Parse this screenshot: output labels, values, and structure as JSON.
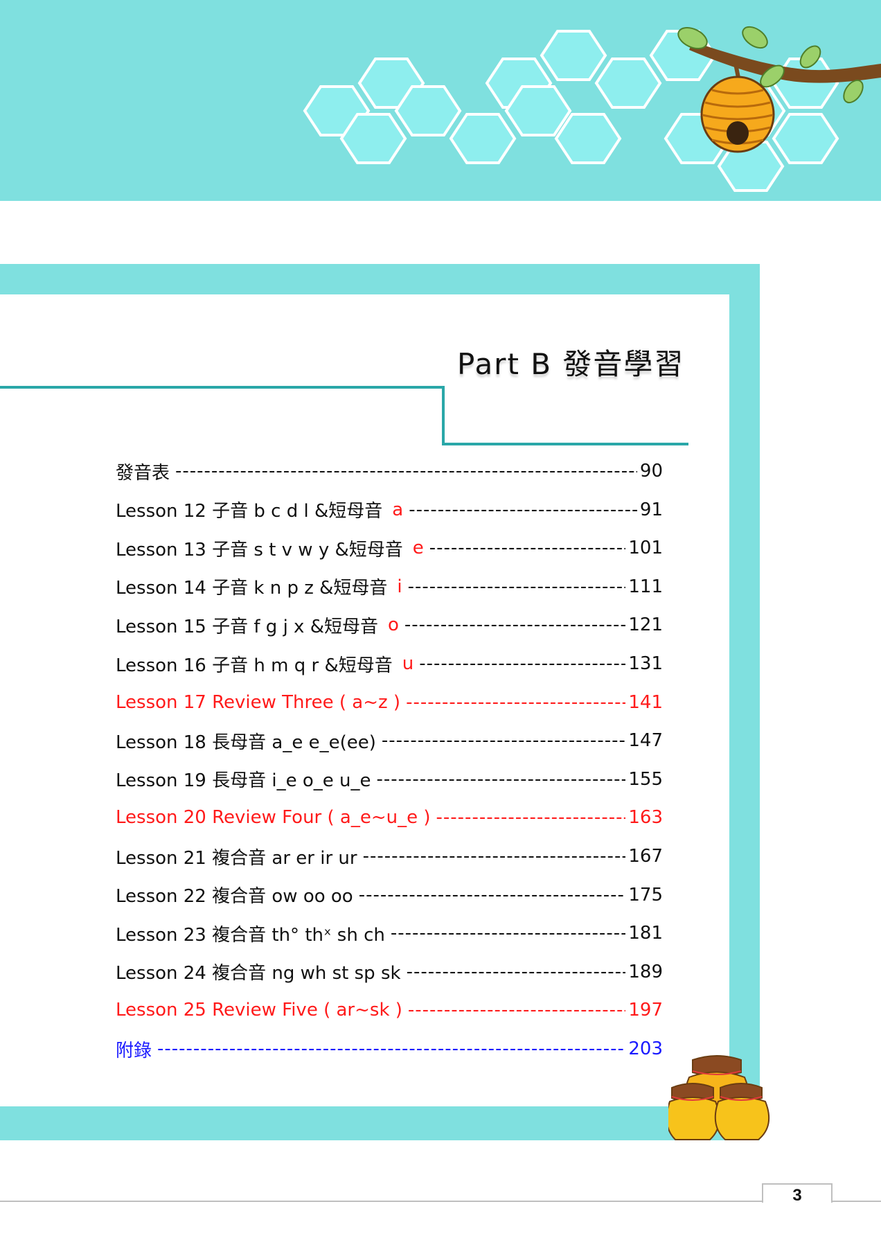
{
  "title": "Part B 發音學習",
  "toc": [
    {
      "label": "發音表",
      "highlight": "",
      "page": "90",
      "style": "normal"
    },
    {
      "label": "Lesson 12 子音 b c d l &短母音",
      "highlight": "a",
      "page": "91",
      "style": "normal"
    },
    {
      "label": "Lesson 13 子音 s t v w y &短母音",
      "highlight": "e",
      "page": "101",
      "style": "normal"
    },
    {
      "label": "Lesson 14 子音 k n p z &短母音",
      "highlight": "i",
      "page": "111",
      "style": "normal"
    },
    {
      "label": "Lesson 15 子音 f g j x &短母音",
      "highlight": "o",
      "page": "121",
      "style": "normal"
    },
    {
      "label": "Lesson 16 子音 h m q r &短母音",
      "highlight": "u",
      "page": "131",
      "style": "normal"
    },
    {
      "label": "Lesson 17 Review Three ( a~z )",
      "highlight": "",
      "page": "141",
      "style": "red"
    },
    {
      "label": "Lesson 18 長母音 a_e e_e(ee)",
      "highlight": "",
      "page": "147",
      "style": "normal"
    },
    {
      "label": "Lesson 19 長母音 i_e o_e u_e",
      "highlight": "",
      "page": "155",
      "style": "normal"
    },
    {
      "label": "Lesson 20 Review Four ( a_e~u_e )",
      "highlight": "",
      "page": "163",
      "style": "red"
    },
    {
      "label": "Lesson 21 複合音 ar er ir ur",
      "highlight": "",
      "page": "167",
      "style": "normal"
    },
    {
      "label": "Lesson 22 複合音 ow oo oo",
      "highlight": "",
      "page": "175",
      "style": "normal"
    },
    {
      "label": "Lesson 23 複合音 th° thˣ sh ch",
      "highlight": "",
      "page": "181",
      "style": "normal"
    },
    {
      "label": "Lesson 24 複合音 ng wh st sp sk",
      "highlight": "",
      "page": "189",
      "style": "normal"
    },
    {
      "label": "Lesson 25 Review Five ( ar~sk )",
      "highlight": "",
      "page": "197",
      "style": "red"
    },
    {
      "label": "附錄",
      "highlight": "",
      "page": "203",
      "style": "blue"
    }
  ],
  "leader": "-------------------------------------------------------------------------------------------------------------",
  "page_number": "3",
  "colors": {
    "band": "#7fe0df",
    "accent_line": "#2aa7a8",
    "red": "#ff1a1a",
    "blue": "#1a1aff"
  },
  "icons": [
    "beehive-icon",
    "honey-pots-icon"
  ]
}
